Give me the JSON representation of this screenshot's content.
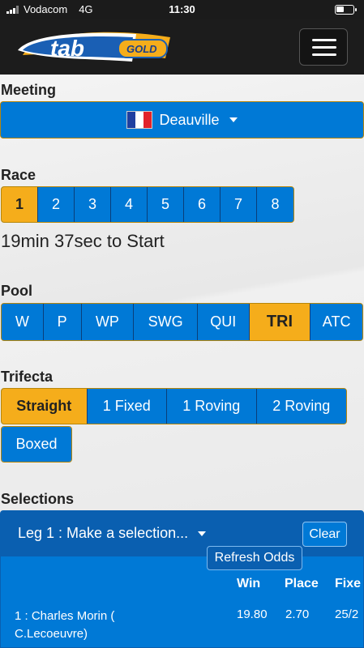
{
  "status_bar": {
    "carrier": "Vodacom",
    "network": "4G",
    "time": "11:30"
  },
  "header": {
    "logo_text": "tab",
    "logo_badge": "GOLD",
    "menu_icon": "hamburger-menu-icon"
  },
  "meeting": {
    "label": "Meeting",
    "selected": "Deauville",
    "flag_icon": "france-flag-icon",
    "flag_colors": [
      "#1f3fa0",
      "#ffffff",
      "#e2232a"
    ]
  },
  "race": {
    "label": "Race",
    "items": [
      "1",
      "2",
      "3",
      "4",
      "5",
      "6",
      "7",
      "8"
    ],
    "active": "1",
    "countdown": "19min 37sec to Start"
  },
  "pool": {
    "label": "Pool",
    "items": [
      "W",
      "P",
      "WP",
      "SWG",
      "QUI",
      "TRI",
      "ATC"
    ],
    "active": "TRI"
  },
  "trifecta": {
    "label": "Trifecta",
    "items": [
      "Straight",
      "1 Fixed",
      "1 Roving",
      "2 Roving",
      "Boxed"
    ],
    "active": "Straight"
  },
  "selections": {
    "label": "Selections",
    "leg_title": "Leg 1 : Make a selection...",
    "clear_label": "Clear",
    "refresh_label": "Refresh Odds",
    "columns": [
      "Win",
      "Place",
      "Fixe"
    ],
    "runners": [
      {
        "name": "1 : Charles Morin ( C.Lecoeuvre)",
        "win": "19.80",
        "place": "2.70",
        "fixed": "25/2"
      }
    ]
  },
  "colors": {
    "accent_blue": "#0079d6",
    "active_gold": "#f5ad1b",
    "navbar": "#1c1c1c"
  }
}
